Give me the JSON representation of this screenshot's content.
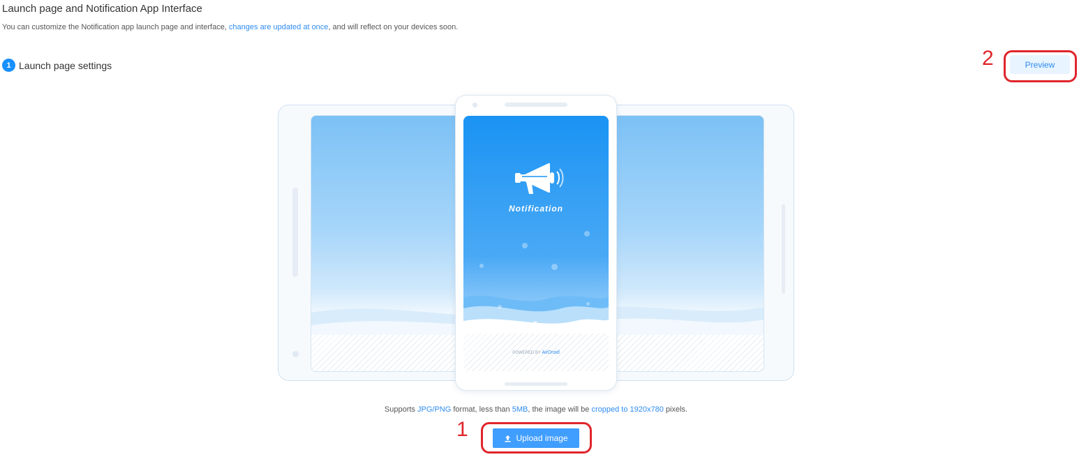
{
  "header": {
    "title": "Launch page and Notification App Interface",
    "subtitle_part1": "You can customize the Notification app launch page and interface, ",
    "subtitle_link": "changes are updated at once",
    "subtitle_part2": ", and will reflect on your devices soon."
  },
  "step": {
    "number": "1",
    "label": "Launch page settings"
  },
  "preview": {
    "label": "Preview",
    "callout": "2"
  },
  "mockup": {
    "app_name": "Notification",
    "powered_by": "POWERED BY",
    "brand": "AirDroid"
  },
  "support": {
    "part1": "Supports ",
    "format": "JPG/PNG",
    "part2": " format, less than ",
    "size": "5MB",
    "part3": ", the image will be ",
    "crop": "cropped to 1920x780",
    "part4": " pixels."
  },
  "upload": {
    "label": "Upload image",
    "callout": "1"
  },
  "colors": {
    "accent": "#2d8cf0",
    "button_primary": "#409eff",
    "annotation": "#e0252b"
  },
  "icons": {
    "step": "step-number-badge",
    "upload": "upload-icon",
    "app": "megaphone-icon"
  }
}
